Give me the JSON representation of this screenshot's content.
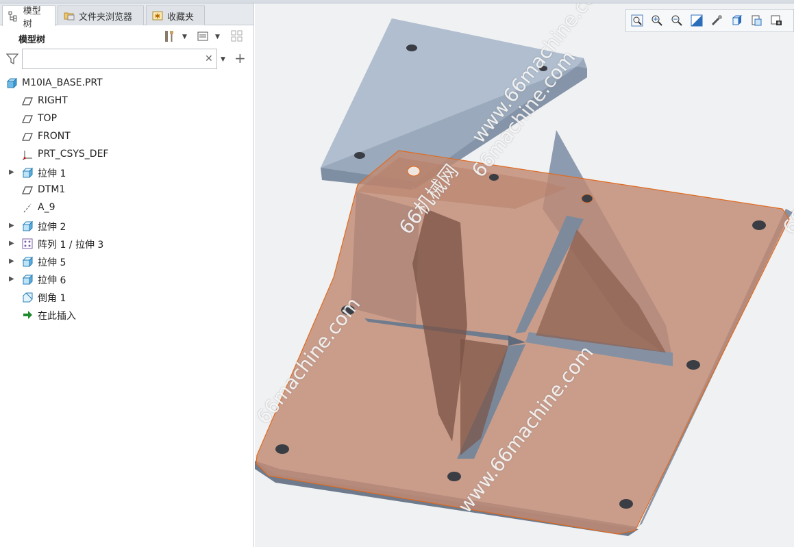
{
  "tabs": [
    {
      "label": "模型树",
      "icon": "tree-icon",
      "active": true
    },
    {
      "label": "文件夹浏览器",
      "icon": "folder-browser-icon",
      "active": false
    },
    {
      "label": "收藏夹",
      "icon": "favorites-icon",
      "active": false
    }
  ],
  "panel": {
    "title": "模型树",
    "search_value": "",
    "search_placeholder": ""
  },
  "tree": [
    {
      "label": "M10IA_BASE.PRT",
      "icon": "part-icon",
      "level": 0,
      "expandable": false
    },
    {
      "label": "RIGHT",
      "icon": "datum-plane-icon",
      "level": 1,
      "expandable": false
    },
    {
      "label": "TOP",
      "icon": "datum-plane-icon",
      "level": 1,
      "expandable": false
    },
    {
      "label": "FRONT",
      "icon": "datum-plane-icon",
      "level": 1,
      "expandable": false
    },
    {
      "label": "PRT_CSYS_DEF",
      "icon": "csys-icon",
      "level": 1,
      "expandable": false
    },
    {
      "label": "拉伸 1",
      "icon": "extrude-icon",
      "level": 1,
      "expandable": true
    },
    {
      "label": "DTM1",
      "icon": "datum-plane-icon",
      "level": 1,
      "expandable": false
    },
    {
      "label": "A_9",
      "icon": "axis-icon",
      "level": 1,
      "expandable": false
    },
    {
      "label": "拉伸 2",
      "icon": "extrude-icon",
      "level": 1,
      "expandable": true
    },
    {
      "label": "阵列 1 / 拉伸 3",
      "icon": "pattern-icon",
      "level": 1,
      "expandable": true
    },
    {
      "label": "拉伸 5",
      "icon": "extrude-icon",
      "level": 1,
      "expandable": true
    },
    {
      "label": "拉伸 6",
      "icon": "extrude-icon",
      "level": 1,
      "expandable": true
    },
    {
      "label": "倒角 1",
      "icon": "chamfer-icon",
      "level": 1,
      "expandable": false
    },
    {
      "label": "在此插入",
      "icon": "insert-here-icon",
      "level": 1,
      "expandable": false
    }
  ],
  "view_toolbar": [
    "refit-icon",
    "zoom-in-icon",
    "zoom-out-icon",
    "repaint-icon",
    "display-style-icon",
    "saved-orientations-icon",
    "view-manager-icon",
    "named-views-icon"
  ],
  "watermarks": [
    "66machine.com",
    "www.66machine.com",
    "66机械网",
    "66machine.com",
    "www.66machine.com",
    "66机械网",
    "www.66machine.com",
    "66机械网"
  ],
  "colors": {
    "selection": "#e06a1f",
    "part_gray": "#a9b8c9",
    "highlight_fill": "#c08670"
  }
}
